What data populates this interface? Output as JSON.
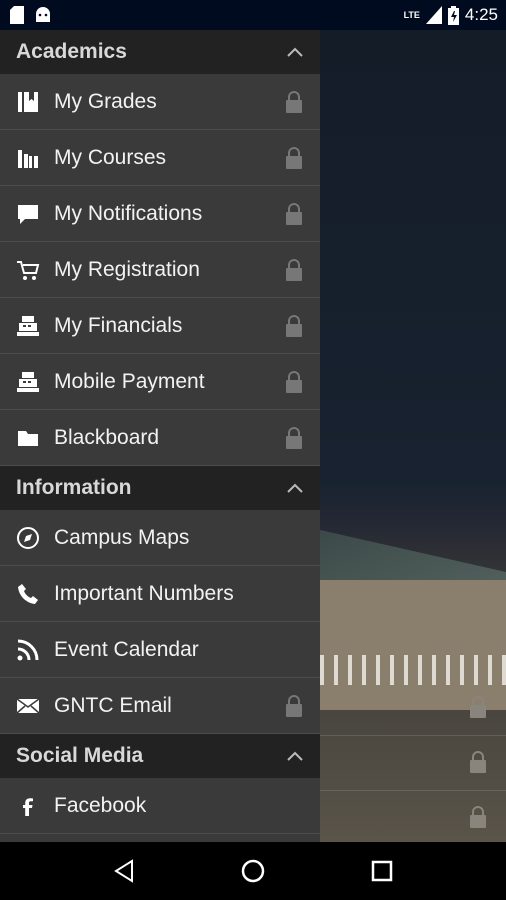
{
  "status_bar": {
    "time": "4:25",
    "network": "LTE"
  },
  "sections": [
    {
      "title": "Academics",
      "items": [
        {
          "label": "My Grades",
          "icon": "book-icon",
          "locked": true
        },
        {
          "label": "My Courses",
          "icon": "books-icon",
          "locked": true
        },
        {
          "label": "My Notifications",
          "icon": "chat-bubble-icon",
          "locked": true
        },
        {
          "label": "My Registration",
          "icon": "cart-icon",
          "locked": true
        },
        {
          "label": "My Financials",
          "icon": "cash-register-icon",
          "locked": true
        },
        {
          "label": "Mobile Payment",
          "icon": "cash-register-icon",
          "locked": true
        },
        {
          "label": "Blackboard",
          "icon": "folder-icon",
          "locked": true
        }
      ]
    },
    {
      "title": "Information",
      "items": [
        {
          "label": "Campus Maps",
          "icon": "compass-icon",
          "locked": false
        },
        {
          "label": "Important Numbers",
          "icon": "phone-icon",
          "locked": false
        },
        {
          "label": "Event Calendar",
          "icon": "rss-icon",
          "locked": false
        },
        {
          "label": "GNTC Email",
          "icon": "envelope-icon",
          "locked": true
        }
      ]
    },
    {
      "title": "Social Media",
      "items": [
        {
          "label": "Facebook",
          "icon": "facebook-icon",
          "locked": false
        }
      ]
    }
  ]
}
